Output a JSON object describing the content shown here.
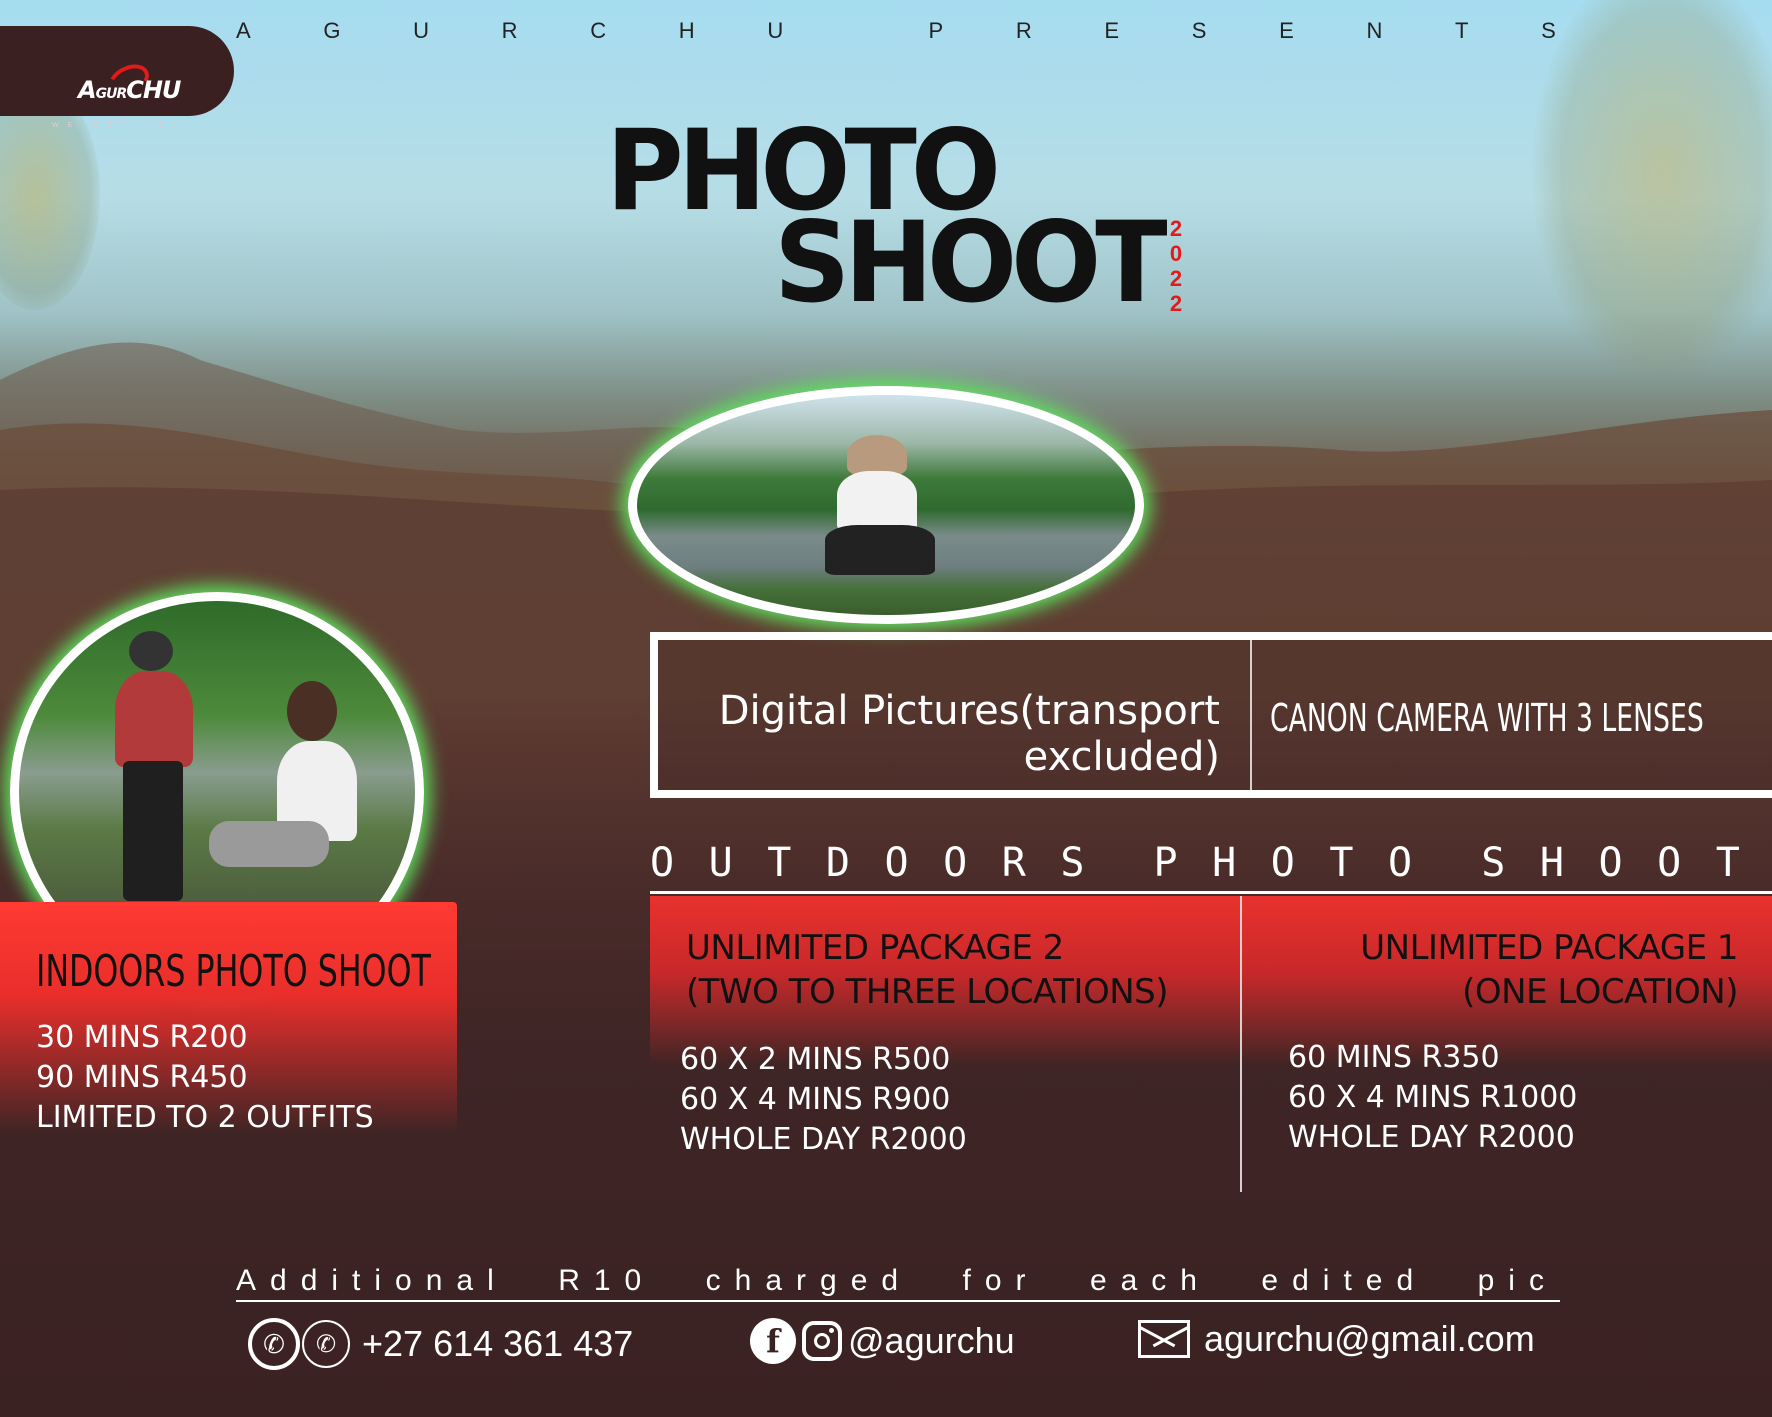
{
  "brand": {
    "logo_text_a": "A",
    "logo_text_gur": "GUR",
    "logo_text_chu": "CHU",
    "tagline": "WE GOT YOU",
    "presents_letters": [
      "A",
      "G",
      "U",
      "R",
      "C",
      "H",
      "U",
      "",
      "P",
      "R",
      "E",
      "S",
      "E",
      "N",
      "T",
      "S"
    ],
    "accent_color": "#e11b1b",
    "glow_color": "#5fe35f"
  },
  "title": {
    "line1": "PHOTO",
    "line2": "SHOOT",
    "year_digits": [
      "2",
      "0",
      "2",
      "2"
    ]
  },
  "info": {
    "digital": "Digital Pictures(transport excluded)",
    "camera": "CANON CAMERA WITH 3 LENSES"
  },
  "outdoors": {
    "heading_letters": [
      "O",
      "U",
      "T",
      "D",
      "O",
      "O",
      "R",
      "S",
      "",
      "P",
      "H",
      "O",
      "T",
      "O",
      "",
      "S",
      "H",
      "O",
      "O",
      "T"
    ],
    "package2": {
      "title_line1": "UNLIMITED PACKAGE 2",
      "title_line2": "(TWO TO THREE LOCATIONS)",
      "items": [
        "60 X 2 MINS R500",
        "60 X 4 MINS R900",
        "WHOLE DAY R2000"
      ]
    },
    "package1": {
      "title_line1": "UNLIMITED PACKAGE 1",
      "title_line2": "(ONE LOCATION)",
      "items": [
        "60 MINS R350",
        "60 X 4 MINS R1000",
        "WHOLE DAY R2000"
      ]
    }
  },
  "indoors": {
    "title": "INDOORS PHOTO SHOOT",
    "items": [
      "30 MINS R200",
      "90 MINS R450",
      "LIMITED TO 2 OUTFITS"
    ]
  },
  "footer": {
    "additional_words": [
      "Additional",
      "R10",
      "charged",
      "for",
      "each",
      "edited",
      "pic"
    ],
    "phone": "+27 614 361 437",
    "handle": "@agurchu",
    "email": "agurchu@gmail.com"
  }
}
